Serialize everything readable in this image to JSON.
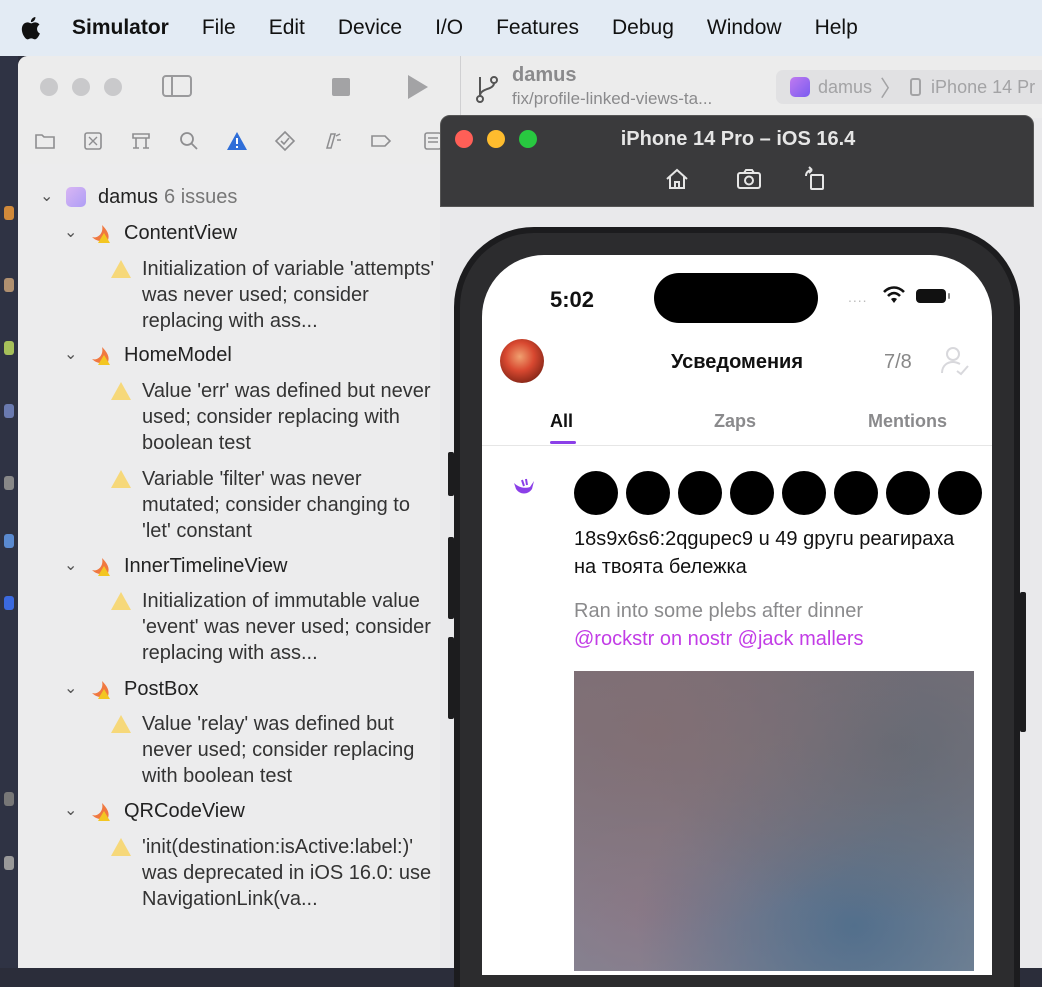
{
  "menubar": {
    "app": "Simulator",
    "items": [
      "File",
      "Edit",
      "Device",
      "I/O",
      "Features",
      "Debug",
      "Window",
      "Help"
    ]
  },
  "xcode": {
    "project": "damus",
    "branch": "fix/profile-linked-views-ta...",
    "scheme": {
      "project": "damus",
      "device": "iPhone 14 Pr"
    }
  },
  "issues": {
    "project": {
      "name": "damus",
      "count": "6 issues"
    },
    "groups": [
      {
        "file": "ContentView",
        "issues": [
          "Initialization of variable 'attempts' was never used; consider replacing with ass..."
        ]
      },
      {
        "file": "HomeModel",
        "issues": [
          "Value 'err' was defined but never used; consider replacing with boolean test",
          "Variable 'filter' was never mutated; consider changing to 'let' constant"
        ]
      },
      {
        "file": "InnerTimelineView",
        "issues": [
          "Initialization of immutable value 'event' was never used; consider replacing with ass..."
        ]
      },
      {
        "file": "PostBox",
        "issues": [
          "Value 'relay' was defined but never used; consider replacing with boolean test"
        ]
      },
      {
        "file": "QRCodeView",
        "issues": [
          "'init(destination:isActive:label:)' was deprecated in iOS 16.0: use NavigationLink(va..."
        ]
      }
    ]
  },
  "simulator": {
    "title": "iPhone 14 Pro – iOS 16.4"
  },
  "phone": {
    "time": "5:02",
    "signal": "....",
    "nav_title": "Усведомения",
    "counter": "7/8",
    "tabs": [
      "All",
      "Zaps",
      "Mentions"
    ],
    "reaction_text": "18s9x6s6:2qgupec9 u 49 gpyгu реагираха на твоята бележка",
    "note_text": "Ran into some plebs after dinner",
    "note_mentions": "@rockstr on nostr @jack mallers"
  },
  "colors": {
    "accent_purple": "#8b3fe8",
    "mention_color": "#c23ce6",
    "warning_yellow": "#f3c622"
  }
}
